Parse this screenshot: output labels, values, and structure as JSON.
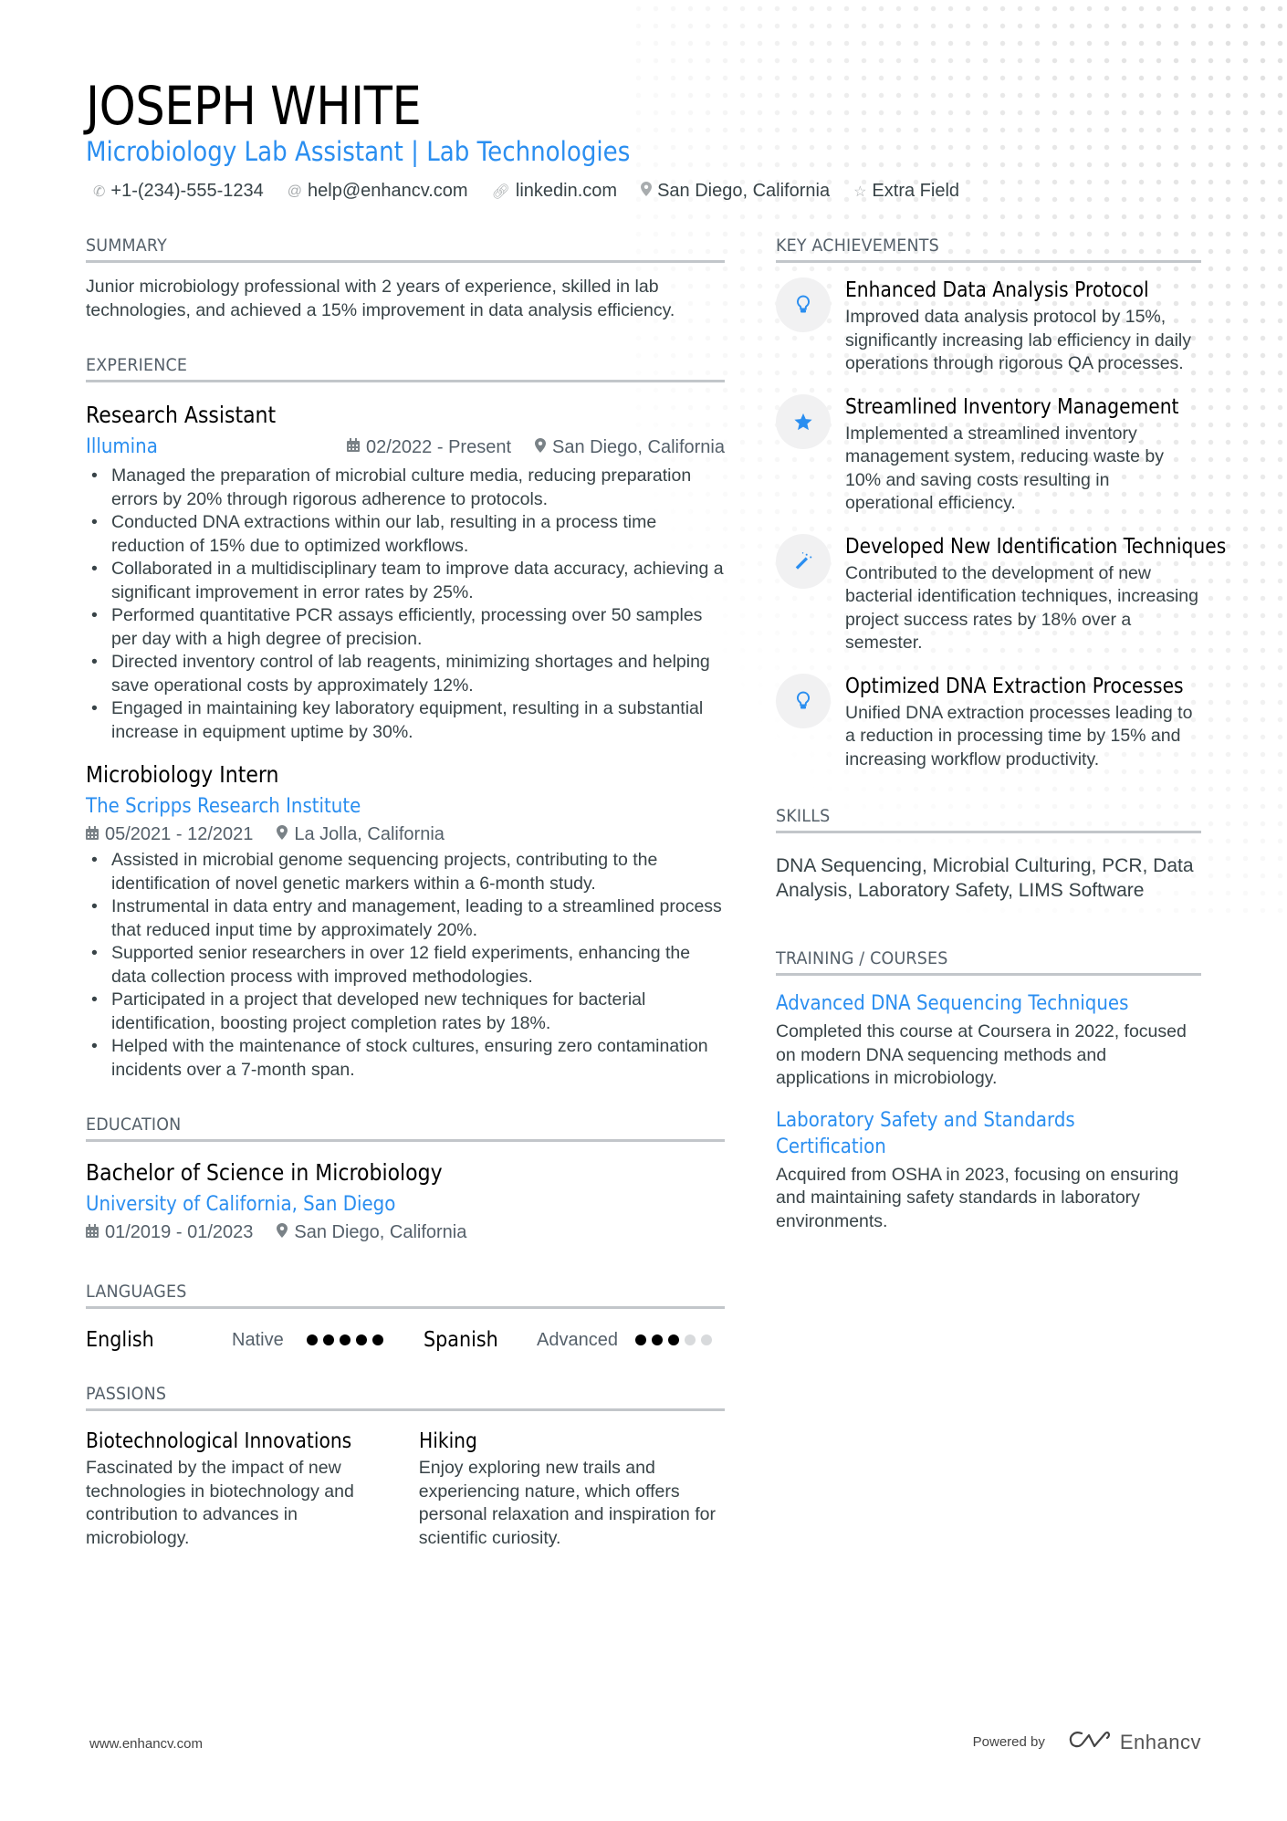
{
  "header": {
    "name": "JOSEPH WHITE",
    "title": "Microbiology Lab Assistant | Lab Technologies",
    "contacts": [
      {
        "icon": "phone-icon",
        "text": "+1-(234)-555-1234"
      },
      {
        "icon": "at-icon",
        "text": "help@enhancv.com"
      },
      {
        "icon": "link-icon",
        "text": "linkedin.com"
      },
      {
        "icon": "location-icon",
        "text": "San Diego, California"
      },
      {
        "icon": "star-icon",
        "text": "Extra Field"
      }
    ]
  },
  "summary": {
    "heading": "SUMMARY",
    "text": "Junior microbiology professional with 2 years of experience, skilled in lab technologies, and achieved a 15% improvement in data analysis efficiency."
  },
  "experience": {
    "heading": "EXPERIENCE",
    "items": [
      {
        "role": "Research Assistant",
        "company": "Illumina",
        "dates": "02/2022 - Present",
        "location": "San Diego, California",
        "bullets": [
          "Managed the preparation of microbial culture media, reducing preparation errors by 20% through rigorous adherence to protocols.",
          "Conducted DNA extractions within our lab, resulting in a process time reduction of 15% due to optimized workflows.",
          "Collaborated in a multidisciplinary team to improve data accuracy, achieving a significant improvement in error rates by 25%.",
          "Performed quantitative PCR assays efficiently, processing over 50 samples per day with a high degree of precision.",
          "Directed inventory control of lab reagents, minimizing shortages and helping save operational costs by approximately 12%.",
          "Engaged in maintaining key laboratory equipment, resulting in a substantial increase in equipment uptime by 30%."
        ]
      },
      {
        "role": "Microbiology Intern",
        "company": "The Scripps Research Institute",
        "dates": "05/2021 - 12/2021",
        "location": "La Jolla, California",
        "bullets": [
          "Assisted in microbial genome sequencing projects, contributing to the identification of novel genetic markers within a 6-month study.",
          "Instrumental in data entry and management, leading to a streamlined process that reduced input time by approximately 20%.",
          "Supported senior researchers in over 12 field experiments, enhancing the data collection process with improved methodologies.",
          "Participated in a project that developed new techniques for bacterial identification, boosting project completion rates by 18%.",
          "Helped with the maintenance of stock cultures, ensuring zero contamination incidents over a 7-month span."
        ]
      }
    ]
  },
  "education": {
    "heading": "EDUCATION",
    "degree": "Bachelor of Science in Microbiology",
    "school": "University of California, San Diego",
    "dates": "01/2019 - 01/2023",
    "location": "San Diego, California"
  },
  "languages": {
    "heading": "LANGUAGES",
    "items": [
      {
        "name": "English",
        "level": "Native",
        "rating": 5,
        "max": 5
      },
      {
        "name": "Spanish",
        "level": "Advanced",
        "rating": 3,
        "max": 5
      }
    ]
  },
  "passions": {
    "heading": "PASSIONS",
    "items": [
      {
        "title": "Biotechnological Innovations",
        "desc": "Fascinated by the impact of new technologies in biotechnology and contribution to advances in microbiology."
      },
      {
        "title": "Hiking",
        "desc": "Enjoy exploring new trails and experiencing nature, which offers personal relaxation and inspiration for scientific curiosity."
      }
    ]
  },
  "achievements": {
    "heading": "KEY ACHIEVEMENTS",
    "items": [
      {
        "icon": "lightbulb-icon",
        "title": "Enhanced Data Analysis Protocol",
        "desc": "Improved data analysis protocol by 15%, significantly increasing lab efficiency in daily operations through rigorous QA processes."
      },
      {
        "icon": "star-icon",
        "title": "Streamlined Inventory Management",
        "desc": "Implemented a streamlined inventory management system, reducing waste by 10% and saving costs resulting in operational efficiency."
      },
      {
        "icon": "magic-wand-icon",
        "title": "Developed New Identification Techniques",
        "desc": "Contributed to the development of new bacterial identification techniques, increasing project success rates by 18% over a semester."
      },
      {
        "icon": "lightbulb-icon",
        "title": "Optimized DNA Extraction Processes",
        "desc": "Unified DNA extraction processes leading to a reduction in processing time by 15% and increasing workflow productivity."
      }
    ]
  },
  "skills": {
    "heading": "SKILLS",
    "text": "DNA Sequencing, Microbial Culturing, PCR, Data Analysis, Laboratory Safety, LIMS Software"
  },
  "training": {
    "heading": "TRAINING / COURSES",
    "items": [
      {
        "title": "Advanced DNA Sequencing Techniques",
        "desc": "Completed this course at Coursera in 2022, focused on modern DNA sequencing methods and applications in microbiology."
      },
      {
        "title": "Laboratory Safety and Standards Certification",
        "desc": "Acquired from OSHA in 2023, focusing on ensuring and maintaining safety standards in laboratory environments."
      }
    ]
  },
  "footer": {
    "website": "www.enhancv.com",
    "powered_by": "Powered by",
    "brand": "Enhancv"
  },
  "colors": {
    "accent": "#2a8ef0",
    "text": "#384347",
    "rule": "#c2c6ca"
  }
}
